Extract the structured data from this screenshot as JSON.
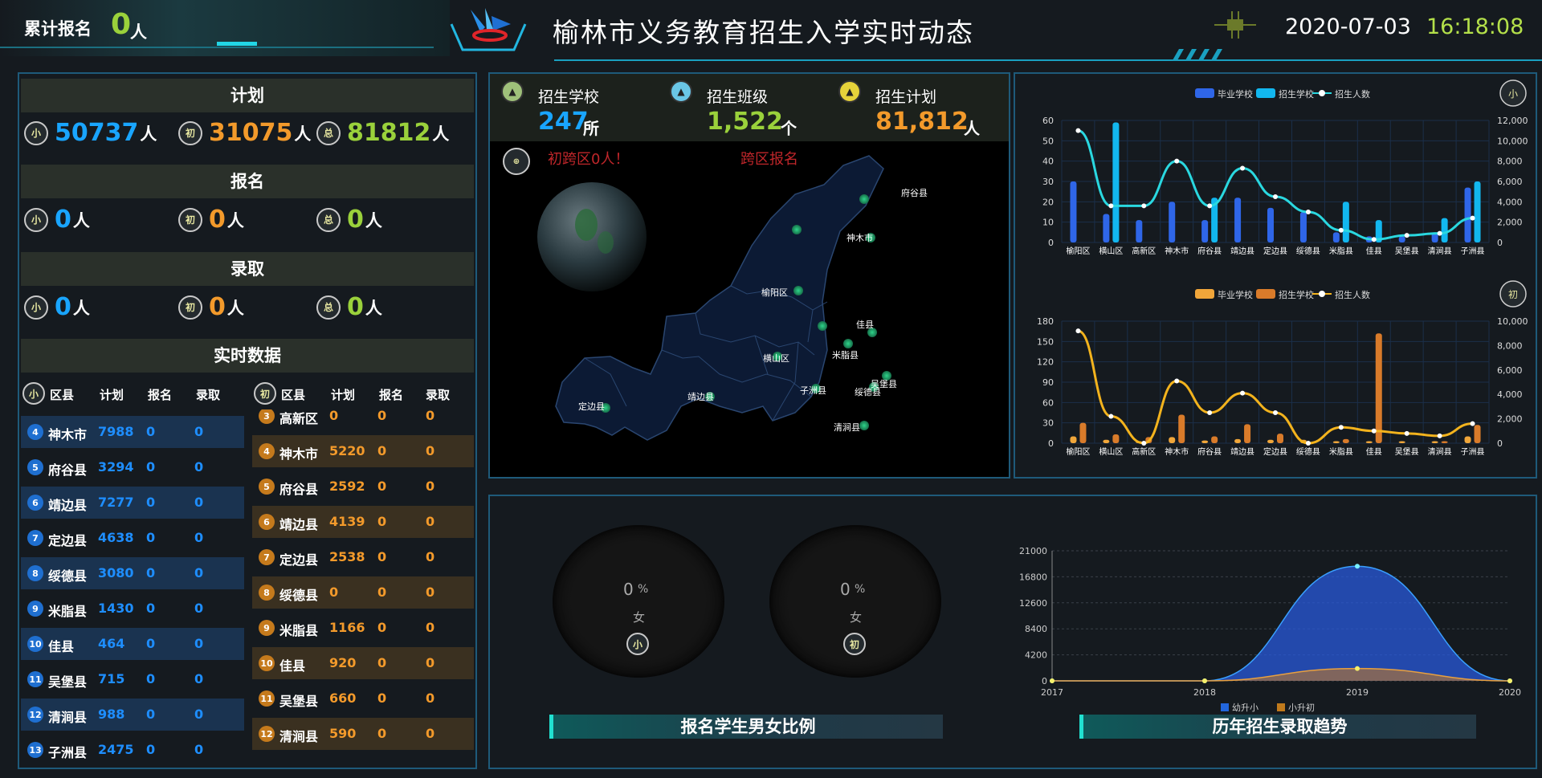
{
  "header": {
    "total_label": "累计报名",
    "total_value": "0",
    "total_unit": "人",
    "title": "榆林市义务教育招生入学实时动态",
    "date": "2020-07-03",
    "time": "16:18:08"
  },
  "left": {
    "plan": {
      "title": "计划",
      "items": [
        {
          "badge": "小",
          "value": "50737",
          "unit": "人",
          "color": "#19a5ff"
        },
        {
          "badge": "初",
          "value": "31075",
          "unit": "人",
          "color": "#f39a2b"
        },
        {
          "badge": "总",
          "value": "81812",
          "unit": "人",
          "color": "#9ad13b"
        }
      ]
    },
    "register": {
      "title": "报名",
      "items": [
        {
          "badge": "小",
          "value": "0",
          "unit": "人"
        },
        {
          "badge": "初",
          "value": "0",
          "unit": "人"
        },
        {
          "badge": "总",
          "value": "0",
          "unit": "人"
        }
      ]
    },
    "admit": {
      "title": "录取",
      "items": [
        {
          "badge": "小",
          "value": "0",
          "unit": "人"
        },
        {
          "badge": "初",
          "value": "0",
          "unit": "人"
        },
        {
          "badge": "总",
          "value": "0",
          "unit": "人"
        }
      ]
    },
    "realtime": {
      "title": "实时数据",
      "primary": {
        "badge": "小",
        "headers": [
          "区县",
          "计划",
          "报名",
          "录取"
        ],
        "rows": [
          {
            "rank": "4",
            "county": "神木市",
            "plan": "7988",
            "reg": "0",
            "adm": "0"
          },
          {
            "rank": "5",
            "county": "府谷县",
            "plan": "3294",
            "reg": "0",
            "adm": "0"
          },
          {
            "rank": "6",
            "county": "靖边县",
            "plan": "7277",
            "reg": "0",
            "adm": "0"
          },
          {
            "rank": "7",
            "county": "定边县",
            "plan": "4638",
            "reg": "0",
            "adm": "0"
          },
          {
            "rank": "8",
            "county": "绥德县",
            "plan": "3080",
            "reg": "0",
            "adm": "0"
          },
          {
            "rank": "9",
            "county": "米脂县",
            "plan": "1430",
            "reg": "0",
            "adm": "0"
          },
          {
            "rank": "10",
            "county": "佳县",
            "plan": "464",
            "reg": "0",
            "adm": "0"
          },
          {
            "rank": "11",
            "county": "吴堡县",
            "plan": "715",
            "reg": "0",
            "adm": "0"
          },
          {
            "rank": "12",
            "county": "清涧县",
            "plan": "988",
            "reg": "0",
            "adm": "0"
          },
          {
            "rank": "13",
            "county": "子洲县",
            "plan": "2475",
            "reg": "0",
            "adm": "0"
          }
        ]
      },
      "junior": {
        "badge": "初",
        "headers": [
          "区县",
          "计划",
          "报名",
          "录取"
        ],
        "rows": [
          {
            "rank": "3",
            "county": "高新区",
            "plan": "0",
            "reg": "0",
            "adm": "0"
          },
          {
            "rank": "4",
            "county": "神木市",
            "plan": "5220",
            "reg": "0",
            "adm": "0"
          },
          {
            "rank": "5",
            "county": "府谷县",
            "plan": "2592",
            "reg": "0",
            "adm": "0"
          },
          {
            "rank": "6",
            "county": "靖边县",
            "plan": "4139",
            "reg": "0",
            "adm": "0"
          },
          {
            "rank": "7",
            "county": "定边县",
            "plan": "2538",
            "reg": "0",
            "adm": "0"
          },
          {
            "rank": "8",
            "county": "绥德县",
            "plan": "0",
            "reg": "0",
            "adm": "0"
          },
          {
            "rank": "9",
            "county": "米脂县",
            "plan": "1166",
            "reg": "0",
            "adm": "0"
          },
          {
            "rank": "10",
            "county": "佳县",
            "plan": "920",
            "reg": "0",
            "adm": "0"
          },
          {
            "rank": "11",
            "county": "吴堡县",
            "plan": "660",
            "reg": "0",
            "adm": "0"
          },
          {
            "rank": "12",
            "county": "清涧县",
            "plan": "590",
            "reg": "0",
            "adm": "0"
          }
        ]
      }
    }
  },
  "mid": {
    "kpis": [
      {
        "label": "招生学校",
        "value": "247",
        "unit": "所",
        "color": "#19a5ff"
      },
      {
        "label": "招生班级",
        "value": "1,522",
        "unit": "个",
        "color": "#9ad13b"
      },
      {
        "label": "招生计划",
        "value": "81,812",
        "unit": "人",
        "color": "#f39a2b"
      }
    ],
    "map": {
      "cross_label": "初跨区0人！",
      "cross_title": "跨区报名",
      "places": [
        "府谷县",
        "神木市",
        "榆阳区",
        "佳县",
        "横山区",
        "米脂县",
        "吴堡县",
        "子洲县",
        "绥德县",
        "清涧县",
        "靖边县",
        "定边县"
      ]
    }
  },
  "chart_data": [
    {
      "type": "bar",
      "title": "",
      "legend": [
        "毕业学校",
        "招生学校",
        "招生人数"
      ],
      "legend_position": "top",
      "categories": [
        "榆阳区",
        "横山区",
        "高新区",
        "神木市",
        "府谷县",
        "靖边县",
        "定边县",
        "绥德县",
        "米脂县",
        "佳县",
        "吴堡县",
        "清涧县",
        "子洲县"
      ],
      "series": [
        {
          "name": "毕业学校",
          "values": [
            30,
            14,
            11,
            20,
            11,
            22,
            17,
            15,
            5,
            3,
            3,
            5,
            27
          ]
        },
        {
          "name": "招生学校",
          "values": [
            0,
            59,
            0,
            0,
            22,
            0,
            0,
            0,
            20,
            11,
            0,
            12,
            30
          ]
        },
        {
          "name": "招生人数",
          "values": [
            11000,
            3600,
            3600,
            8000,
            3600,
            7300,
            4500,
            3000,
            1200,
            300,
            700,
            900,
            2400
          ],
          "axis": "right"
        }
      ],
      "ylim": [
        0,
        60
      ],
      "y2lim": [
        0,
        12000
      ],
      "color": [
        "#2f66e8",
        "#12b7ef",
        "#2ad8e0"
      ]
    },
    {
      "type": "bar",
      "title": "",
      "legend": [
        "毕业学校",
        "招生学校",
        "招生人数"
      ],
      "legend_position": "top",
      "categories": [
        "榆阳区",
        "横山区",
        "高新区",
        "神木市",
        "府谷县",
        "靖边县",
        "定边县",
        "绥德县",
        "米脂县",
        "佳县",
        "吴堡县",
        "清涧县",
        "子洲县"
      ],
      "series": [
        {
          "name": "毕业学校",
          "values": [
            10,
            5,
            3,
            9,
            4,
            6,
            5,
            5,
            3,
            3,
            3,
            3,
            10
          ]
        },
        {
          "name": "招生学校",
          "values": [
            30,
            13,
            9,
            42,
            10,
            28,
            14,
            0,
            6,
            162,
            0,
            3,
            27
          ]
        },
        {
          "name": "招生人数",
          "values": [
            9200,
            2200,
            0,
            5100,
            2500,
            4100,
            2500,
            0,
            1300,
            1000,
            800,
            600,
            1600
          ],
          "axis": "right"
        }
      ],
      "ylim": [
        0,
        180
      ],
      "y2lim": [
        0,
        10000
      ],
      "color": [
        "#f0a63a",
        "#d97b2a",
        "#f3b31d"
      ]
    },
    {
      "type": "area",
      "title": "历年招生录取趋势",
      "legend": [
        "幼升小",
        "小升初"
      ],
      "legend_position": "bottom",
      "x": [
        "2017",
        "2018",
        "2019",
        "2020"
      ],
      "series": [
        {
          "name": "幼升小",
          "values": [
            0,
            0,
            18500,
            0
          ]
        },
        {
          "name": "小升初",
          "values": [
            0,
            0,
            2000,
            0
          ]
        }
      ],
      "ylim": [
        0,
        21000
      ],
      "yticks": [
        0,
        4200,
        8400,
        12600,
        16800,
        21000
      ]
    }
  ],
  "bottom": {
    "gauges": [
      {
        "value": "0",
        "unit": "%",
        "label": "女",
        "badge": "小"
      },
      {
        "value": "0",
        "unit": "%",
        "label": "女",
        "badge": "初"
      }
    ],
    "gender_title": "报名学生男女比例",
    "trend_title": "历年招生录取趋势"
  }
}
